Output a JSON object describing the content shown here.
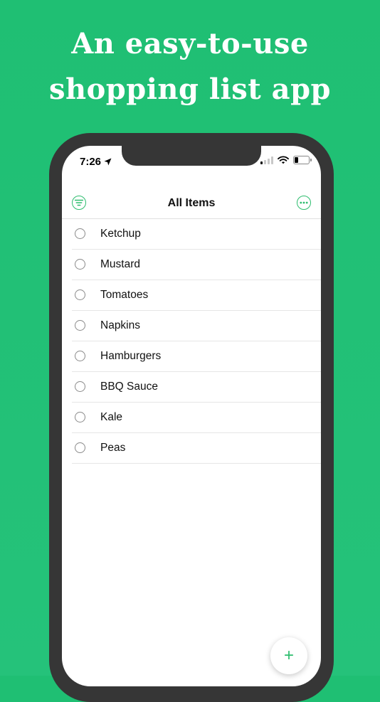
{
  "headline": {
    "line1": "An easy-to-use",
    "line2": "shopping list app"
  },
  "status_bar": {
    "time": "7:26",
    "location_icon": "location-arrow-icon",
    "signal_icon": "cellular-signal-icon",
    "wifi_icon": "wifi-icon",
    "battery_icon": "battery-icon",
    "battery_level": 0.25
  },
  "navbar": {
    "title": "All Items",
    "left_icon": "filter-icon",
    "right_icon": "more-options-icon"
  },
  "items": [
    {
      "label": "Ketchup"
    },
    {
      "label": "Mustard"
    },
    {
      "label": "Tomatoes"
    },
    {
      "label": "Napkins"
    },
    {
      "label": "Hamburgers"
    },
    {
      "label": "BBQ Sauce"
    },
    {
      "label": "Kale"
    },
    {
      "label": "Peas"
    }
  ],
  "fab": {
    "symbol": "+",
    "icon": "add-icon"
  },
  "colors": {
    "background": "#1fbf73",
    "accent": "#2dbd6e",
    "phone_frame": "#363636"
  }
}
